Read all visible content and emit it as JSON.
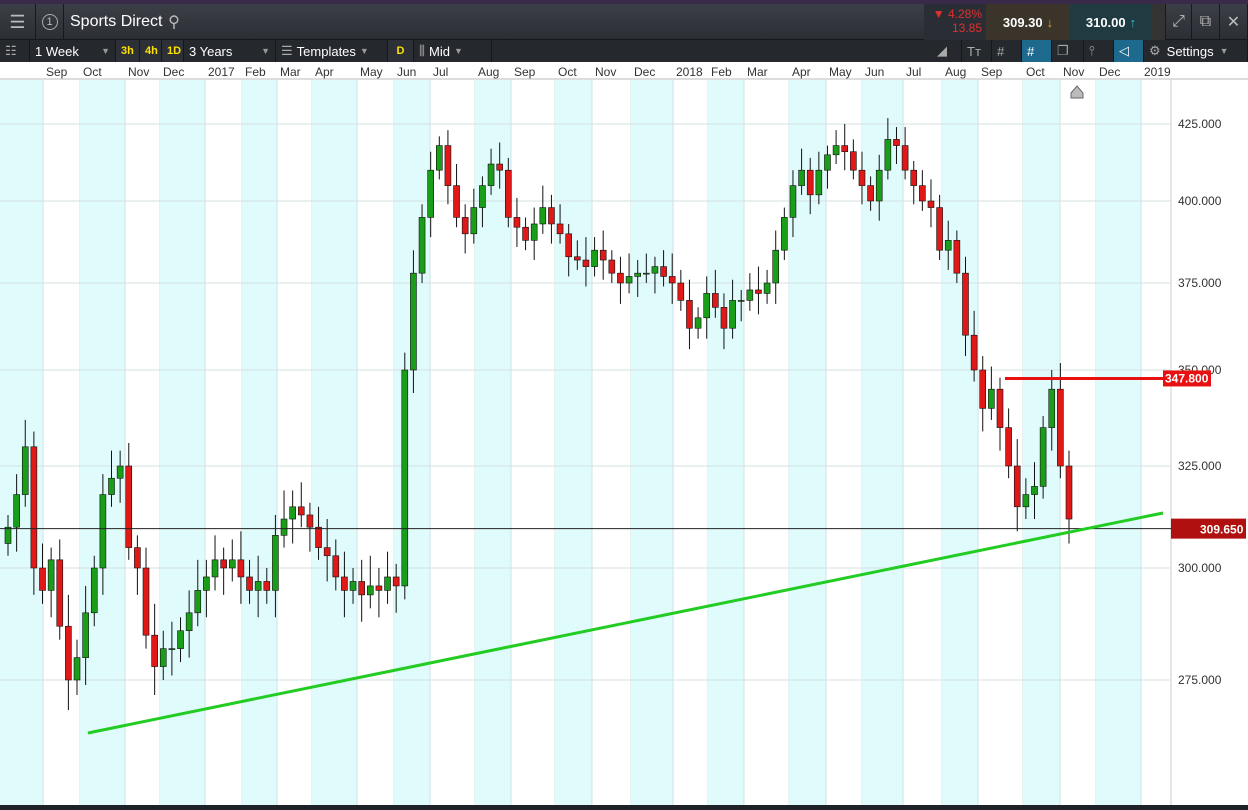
{
  "window": {
    "title": "Sports Direct",
    "badge": "1",
    "change_pct": "▼ 4.28%",
    "change_abs": "13.85",
    "sell": "309.30",
    "buy": "310.00"
  },
  "toolbar": {
    "interval": "1 Week",
    "q1": "3h",
    "q2": "4h",
    "q3": "1D",
    "range": "3 Years",
    "templates": "Templates",
    "d": "D",
    "price_type": "Mid",
    "settings": "Settings"
  },
  "colors": {
    "up": "#1a9e1a",
    "down": "#e01818",
    "trend": "#22cc22",
    "level": "#e81010",
    "stripe": "#e0fbfc"
  },
  "chart_data": {
    "type": "candlestick",
    "title": "Sports Direct",
    "x_labels": [
      "Sep",
      "Oct",
      "Nov",
      "Dec",
      "2017",
      "Feb",
      "Mar",
      "Apr",
      "May",
      "Jun",
      "Jul",
      "Aug",
      "Sep",
      "Oct",
      "Nov",
      "Dec",
      "2018",
      "Feb",
      "Mar",
      "Apr",
      "May",
      "Jun",
      "Jul",
      "Aug",
      "Sep",
      "Oct",
      "Nov",
      "Dec",
      "2019"
    ],
    "y_ticks": [
      "275.000",
      "300.000",
      "325.000",
      "350.000",
      "375.000",
      "400.000",
      "425.000"
    ],
    "y_tick_values": [
      275,
      300,
      325,
      350,
      375,
      400,
      425
    ],
    "closes": [
      310,
      318,
      330,
      300,
      295,
      302,
      287,
      275,
      280,
      290,
      300,
      318,
      322,
      325,
      305,
      300,
      285,
      278,
      282,
      282,
      286,
      290,
      295,
      298,
      302,
      300,
      302,
      298,
      295,
      297,
      295,
      308,
      312,
      315,
      313,
      310,
      305,
      303,
      298,
      295,
      297,
      294,
      296,
      295,
      298,
      296,
      350,
      378,
      395,
      410,
      418,
      405,
      395,
      390,
      398,
      405,
      412,
      410,
      395,
      392,
      388,
      393,
      398,
      393,
      390,
      383,
      382,
      380,
      385,
      382,
      378,
      375,
      377,
      378,
      378,
      380,
      377,
      375,
      370,
      362,
      365,
      372,
      368,
      362,
      370,
      370,
      373,
      372,
      375,
      385,
      395,
      405,
      410,
      402,
      410,
      415,
      418,
      416,
      410,
      405,
      400,
      410,
      420,
      418,
      410,
      405,
      400,
      398,
      385,
      388,
      378,
      360,
      350,
      340,
      345,
      335,
      325,
      315,
      318,
      320,
      335,
      345,
      325,
      312
    ],
    "current_price": 309.65,
    "current_label": "309.650",
    "resistance": 347.8,
    "resistance_label": "347.800",
    "trendline": {
      "from": {
        "date": "Oct 2016",
        "price": 262
      },
      "to": {
        "date": "Dec 2018",
        "price": 312
      }
    }
  }
}
